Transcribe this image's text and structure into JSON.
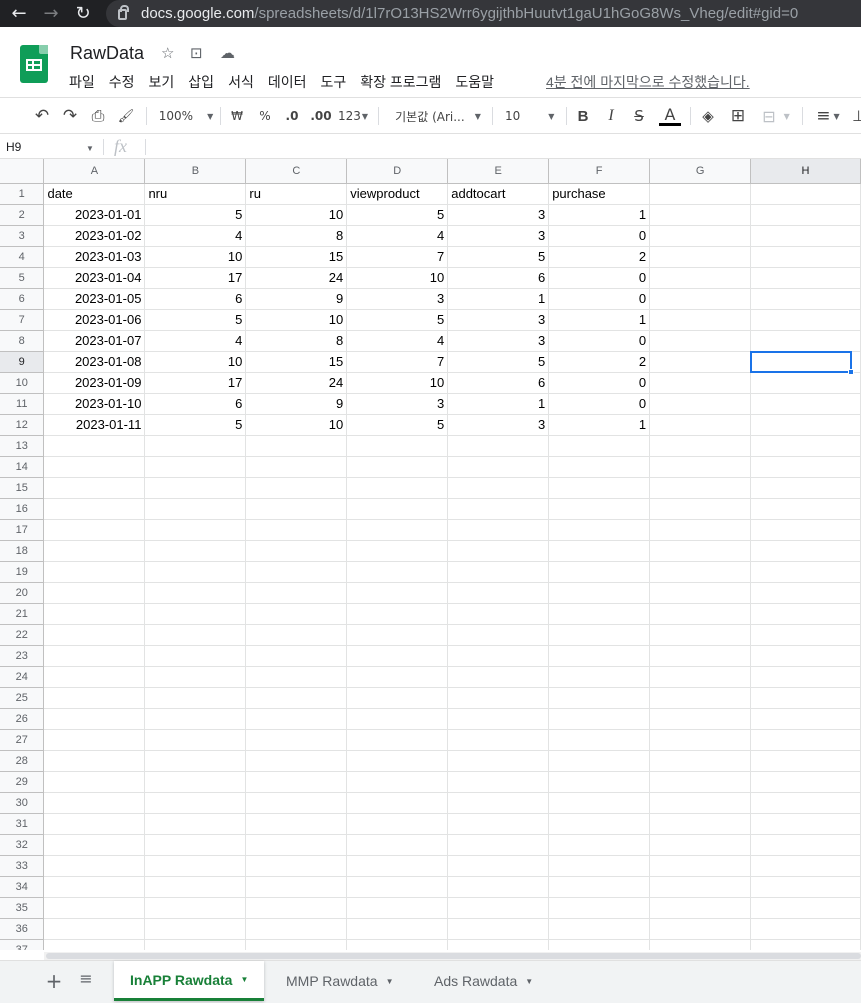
{
  "browser": {
    "back_icon": "←",
    "forward_icon": "→",
    "reload_icon": "↻",
    "url_host": "docs.google.com",
    "url_path": "/spreadsheets/d/1l7rO13HS2Wrr6ygijthbHuutvt1gaU1hGoG8Ws_Vheg/edit#gid=0"
  },
  "header": {
    "title": "RawData",
    "star_icon": "☆",
    "move_icon": "⊡",
    "cloud_icon": "☁",
    "menu": [
      "파일",
      "수정",
      "보기",
      "삽입",
      "서식",
      "데이터",
      "도구",
      "확장 프로그램",
      "도움말"
    ],
    "last_edit": "4분 전에 마지막으로 수정했습니다."
  },
  "toolbar": {
    "undo": "↶",
    "redo": "↷",
    "print": "⎙",
    "paint": "🖌",
    "zoom": "100%",
    "currency": "₩",
    "percent": "%",
    "dec_decrease": ".0",
    "dec_increase": ".00",
    "format_more": "123",
    "font": "기본값 (Ari...",
    "font_size": "10",
    "bold": "B",
    "italic": "I",
    "strike": "S",
    "text_color": "A",
    "fill": "◈",
    "borders": "⊞",
    "merge": "⊟",
    "align": "≡",
    "caret": "▼"
  },
  "formula_bar": {
    "name_box": "H9",
    "fx": "fx",
    "value": ""
  },
  "grid": {
    "columns": [
      "A",
      "B",
      "C",
      "D",
      "E",
      "F",
      "G",
      "H"
    ],
    "selected_column": "H",
    "selected_row": 9,
    "header_row": [
      "date",
      "nru",
      "ru",
      "viewproduct",
      "addtocart",
      "purchase"
    ],
    "rows": [
      [
        "2023-01-01",
        "5",
        "10",
        "5",
        "3",
        "1"
      ],
      [
        "2023-01-02",
        "4",
        "8",
        "4",
        "3",
        "0"
      ],
      [
        "2023-01-03",
        "10",
        "15",
        "7",
        "5",
        "2"
      ],
      [
        "2023-01-04",
        "17",
        "24",
        "10",
        "6",
        "0"
      ],
      [
        "2023-01-05",
        "6",
        "9",
        "3",
        "1",
        "0"
      ],
      [
        "2023-01-06",
        "5",
        "10",
        "5",
        "3",
        "1"
      ],
      [
        "2023-01-07",
        "4",
        "8",
        "4",
        "3",
        "0"
      ],
      [
        "2023-01-08",
        "10",
        "15",
        "7",
        "5",
        "2"
      ],
      [
        "2023-01-09",
        "17",
        "24",
        "10",
        "6",
        "0"
      ],
      [
        "2023-01-10",
        "6",
        "9",
        "3",
        "1",
        "0"
      ],
      [
        "2023-01-11",
        "5",
        "10",
        "5",
        "3",
        "1"
      ]
    ],
    "total_rows_visible": 37
  },
  "tabs": {
    "add_icon": "+",
    "list_icon": "≡",
    "sheets": [
      {
        "label": "InAPP Rawdata",
        "active": true
      },
      {
        "label": "MMP Rawdata",
        "active": false
      },
      {
        "label": "Ads Rawdata",
        "active": false
      }
    ],
    "caret": "▼"
  },
  "colors": {
    "accent_green": "#188038",
    "selection_blue": "#1a73e8",
    "sheets_logo": "#0f9d58"
  }
}
